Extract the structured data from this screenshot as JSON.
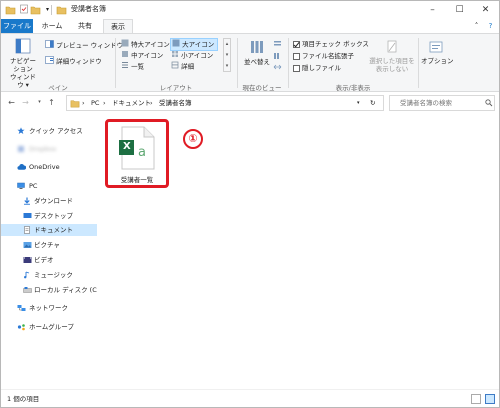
{
  "window": {
    "title": "受講者名簿",
    "controls": {
      "minimize": "–",
      "maximize": "☐",
      "close": "✕"
    }
  },
  "tabs": [
    {
      "label": "ファイル"
    },
    {
      "label": "ホーム"
    },
    {
      "label": "共有"
    },
    {
      "label": "表示"
    }
  ],
  "ribbon": {
    "pane_group": {
      "label": "ペイン",
      "navigation_pane": "ナビゲーション\nウィンドウ ▾",
      "preview_pane": "プレビュー ウィンドウ",
      "details_pane": "詳細ウィンドウ"
    },
    "layout_group": {
      "label": "レイアウト",
      "items": [
        "特大アイコン",
        "大アイコン",
        "中アイコン",
        "小アイコン",
        "一覧",
        "詳細"
      ],
      "selected": "大アイコン"
    },
    "current_view_group": {
      "label": "現在のビュー",
      "sort": "並べ替え"
    },
    "show_hide_group": {
      "label": "表示/非表示",
      "item_checkboxes": "項目チェック ボックス",
      "file_extensions": "ファイル名拡張子",
      "hidden_items": "隠しファイル",
      "hide_selected": "選択した項目を\n表示しない",
      "item_checkboxes_checked": true,
      "file_extensions_checked": false,
      "hidden_items_checked": false
    },
    "options": "オプション"
  },
  "address": {
    "breadcrumbs": [
      "PC",
      "ドキュメント",
      "受講者名簿"
    ],
    "separator": "›"
  },
  "search": {
    "placeholder": "受講者名簿の検索"
  },
  "navpane": {
    "items": [
      {
        "label": "クイック アクセス",
        "icon": "star-icon"
      },
      {
        "label": "Dropbox",
        "icon": "dropbox-icon",
        "blurred": true
      },
      {
        "label": "OneDrive",
        "icon": "cloud-icon"
      },
      {
        "label": "PC",
        "icon": "pc-icon"
      },
      {
        "label": "ダウンロード",
        "icon": "download-icon"
      },
      {
        "label": "デスクトップ",
        "icon": "desktop-icon"
      },
      {
        "label": "ドキュメント",
        "icon": "document-icon",
        "selected": true
      },
      {
        "label": "ピクチャ",
        "icon": "picture-icon"
      },
      {
        "label": "ビデオ",
        "icon": "video-icon"
      },
      {
        "label": "ミュージック",
        "icon": "music-icon"
      },
      {
        "label": "ローカル ディスク (C:)",
        "icon": "disk-icon"
      },
      {
        "label": "ネットワーク",
        "icon": "network-icon"
      },
      {
        "label": "ホームグループ",
        "icon": "homegroup-icon"
      }
    ]
  },
  "content": {
    "file": {
      "name": "受講者一覧",
      "icon": "excel-file-icon",
      "icon_letter": "X",
      "icon_sub": "a"
    },
    "callout": "①"
  },
  "status": {
    "count": "1 個の項目"
  },
  "colors": {
    "accent": "#1979ca",
    "highlight": "#e01b24",
    "excel": "#1d6f42",
    "selected": "#cce8ff"
  }
}
